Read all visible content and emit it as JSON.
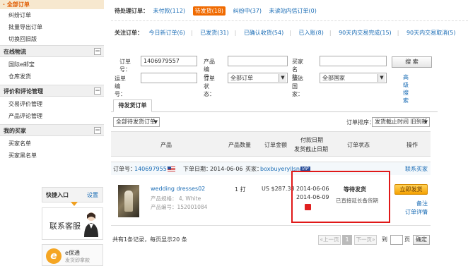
{
  "sidebar": {
    "active_item": "全部订单",
    "top_items": [
      "纠纷订单",
      "批量导出订单",
      "切换回旧版"
    ],
    "groups": [
      {
        "title": "在线物流",
        "items": [
          "国际e邮宝",
          "仓库发货"
        ]
      },
      {
        "title": "评价和评论管理",
        "items": [
          "交易评价管理",
          "产品评论管理"
        ]
      },
      {
        "title": "我的买家",
        "items": [
          "买家名单",
          "买家黑名单"
        ]
      }
    ],
    "toggle_symbol": "−",
    "quick_entry": {
      "title": "快捷入口",
      "settings": "设置"
    },
    "customer_service": "联系客服",
    "escrow": {
      "line1": "e保通",
      "line2": "发货即拿款"
    }
  },
  "status_row": {
    "label": "待处理订单：",
    "tabs": [
      {
        "text": "未付款(112)",
        "active": false
      },
      {
        "text": "待发货(18)",
        "active": true
      },
      {
        "text": "纠纷中(37)",
        "active": false
      },
      {
        "text": "未读站内信订单(0)",
        "active": false
      }
    ]
  },
  "attention_row": {
    "label": "关注订单：",
    "links": [
      "今日新订单(6)",
      "已发货(31)",
      "已确认收货(54)",
      "已入账(8)",
      "90天内交易完成(15)",
      "90天内交易取消(5)"
    ]
  },
  "filters": {
    "order_no_label": "订单号：",
    "order_no_value": "1406979557",
    "product_no_label": "产品编号：",
    "buyer_name_label": "买家名称：",
    "tracking_no_label": "运单编号：",
    "order_status_label": "订单状态：",
    "order_status_value": "全部订单",
    "country_label": "运达国家：",
    "country_value": "全部国家",
    "search_button": "搜 索",
    "advanced_search": "高级搜索"
  },
  "tabs": {
    "current": "待发货订单"
  },
  "list_controls": {
    "select_all": "全部待发货订单",
    "sort_label": "订单排序：",
    "sort_value": "发货截止时间 旧到新"
  },
  "table_header": {
    "product": "产品",
    "quantity": "产品数量",
    "amount": "订单金额",
    "dates_line1": "付款日期",
    "dates_line2": "发货截止日期",
    "status": "订单状态",
    "action": "操作"
  },
  "order": {
    "order_no_label": "订单号：",
    "order_no": "1406979557",
    "order_date_label": "下单日期：",
    "order_date": "2014-06-06",
    "buyer_label": "买家：",
    "buyer": "boxbuyeryllsnake",
    "vip_badge": "VIP",
    "contact_buyer": "联系买家",
    "product_name": "wedding dresses02",
    "product_spec": "产品规格： 4, White",
    "product_no": "产品编号：152001084",
    "quantity": "1 打",
    "amount": "US $287.33",
    "payment_date": "2014-06-06",
    "ship_deadline": "2014-06-09",
    "status": "等待发货",
    "status_sub": "已直接延长备货期",
    "ship_button": "立即发货",
    "note_link": "备注",
    "detail_link": "订单详情"
  },
  "pagination": {
    "summary": "共有1条记录，每页显示20 条",
    "prev": "«上一页",
    "current_page": "1",
    "next": "下一页»",
    "goto_label": "到",
    "page_label": "页",
    "confirm": "确定"
  },
  "colors": {
    "accent_orange": "#f06a00",
    "link_blue": "#1a6cb5",
    "highlight_red": "#e01818"
  }
}
